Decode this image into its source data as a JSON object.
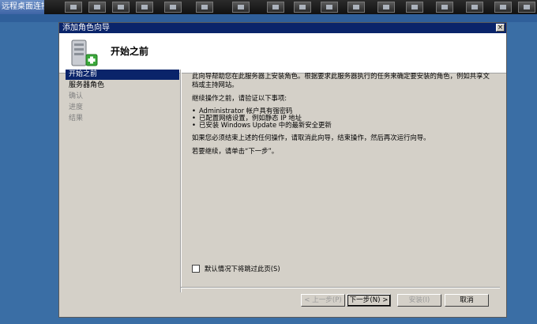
{
  "rdp": {
    "title": "远程桌面连接"
  },
  "window": {
    "title": "添加角色向导",
    "close": "×"
  },
  "header": {
    "title": "开始之前"
  },
  "nav": [
    {
      "label": "开始之前",
      "state": "active"
    },
    {
      "label": "服务器角色",
      "state": "normal"
    },
    {
      "label": "确认",
      "state": "disabled"
    },
    {
      "label": "进度",
      "state": "disabled"
    },
    {
      "label": "结果",
      "state": "disabled"
    }
  ],
  "content": {
    "p1": "此向导帮助您在此服务器上安装角色。根据要求此服务器执行的任务来确定要安装的角色，例如共享文档或主持网站。",
    "p2": "继续操作之前，请验证以下事项:",
    "bullets": [
      "Administrator 帐户具有强密码",
      "已配置网络设置，例如静态 IP 地址",
      "已安装 Windows Update 中的最新安全更新"
    ],
    "p3": "如果您必须结束上述的任何操作，请取消此向导，结束操作，然后再次运行向导。",
    "p4": "若要继续，请单击“下一步”。"
  },
  "skip_label": "默认情况下将跳过此页(S)",
  "buttons": {
    "prev": "< 上一步(P)",
    "next": "下一步(N) >",
    "install": "安装(I)",
    "cancel": "取消"
  },
  "colors": {
    "titlebar": "#0a246a",
    "desktop": "#3a6ea5",
    "selection": "#0a246a"
  }
}
